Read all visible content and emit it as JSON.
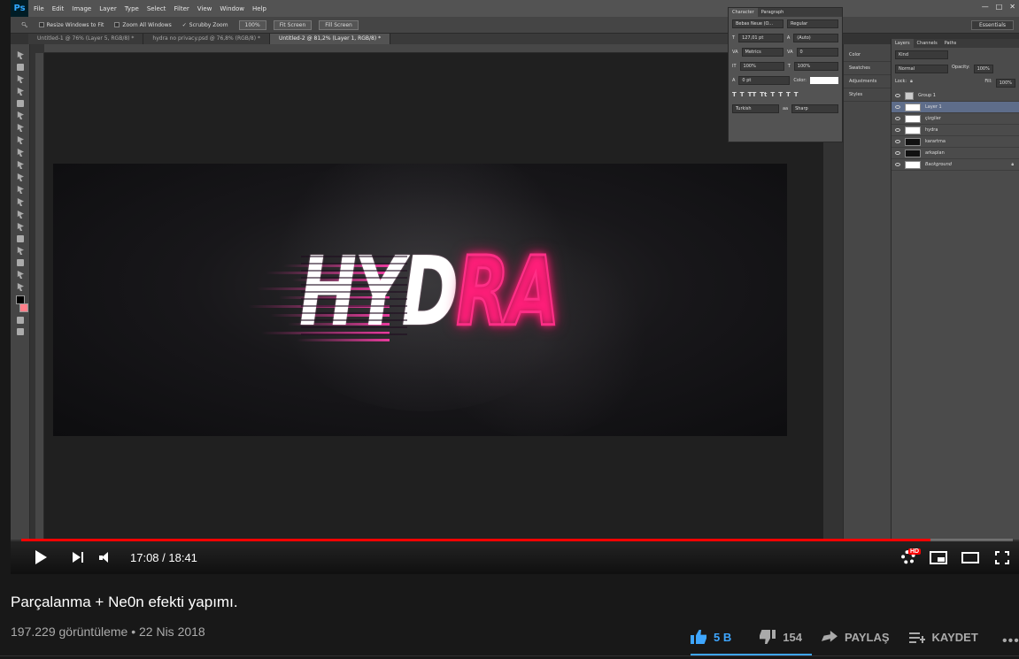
{
  "photoshop": {
    "logo": "Ps",
    "menu": [
      "File",
      "Edit",
      "Image",
      "Layer",
      "Type",
      "Select",
      "Filter",
      "View",
      "Window",
      "Help"
    ],
    "options": {
      "resize": "Resize Windows to Fit",
      "zoom_all": "Zoom All Windows",
      "scrubby": "Scrubby Zoom",
      "percent_btn": "100%",
      "fit_btn": "Fit Screen",
      "fill_btn": "Fill Screen",
      "workspace": "Essentials"
    },
    "tabs": [
      "Untitled-1 @ 76% (Layer 5, RGB/8) *",
      "hydra no privacy.psd @ 76,8% (RGB/8) *",
      "Untitled-2 @ 81,2% (Layer 1, RGB/8) *"
    ],
    "canvas_text": "HYDRA",
    "character_panel": {
      "tabs": [
        "Character",
        "Paragraph"
      ],
      "font": "Bebas Neue (O...",
      "style": "Regular",
      "size": "127,01 pt",
      "leading": "(Auto)",
      "kerning": "Metrics",
      "tracking": "0",
      "vscale": "100%",
      "hscale": "100%",
      "baseline": "0 pt",
      "color_label": "Color:",
      "language": "Turkish",
      "aa_label": "aa",
      "aa": "Sharp"
    },
    "mini_panels": [
      "Color",
      "Swatches",
      "Adjustments",
      "Styles"
    ],
    "layers_panel": {
      "tabs": [
        "Layers",
        "Channels",
        "Paths"
      ],
      "kind": "Kind",
      "blend": "Normal",
      "opacity_label": "Opacity:",
      "opacity": "100%",
      "lock_label": "Lock:",
      "fill_label": "Fill:",
      "fill": "100%",
      "layers": [
        "Group 1",
        "Layer 1",
        "çizgiler",
        "hydra",
        "karartma",
        "arkaplan",
        "Background"
      ]
    }
  },
  "player": {
    "time": "17:08 / 18:41",
    "progress": 0.917,
    "hd_badge": "HD"
  },
  "video": {
    "title": "Parçalanma + Ne0n efekti yapımı.",
    "view_info": "197.229 görüntüleme • 22 Nis 2018",
    "likes": "5 B",
    "dislikes": "154",
    "share": "PAYLAŞ",
    "save": "KAYDET",
    "more": "•••"
  }
}
